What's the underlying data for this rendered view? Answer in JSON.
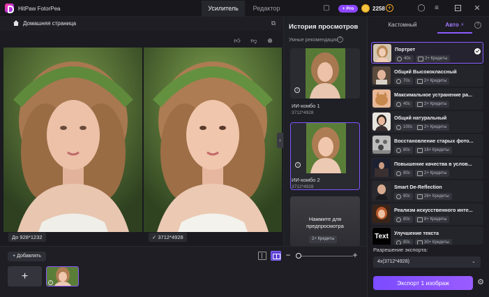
{
  "app": {
    "title": "HitPaw FotorPea",
    "coins": "2258",
    "pro_label": "+ Pro"
  },
  "tabs": {
    "enhancer": "Усилитель",
    "editor": "Редактор"
  },
  "subbar": {
    "home": "Домашняя страница"
  },
  "canvas": {
    "before_label": "До 928*1232",
    "after_label": "3712*4928"
  },
  "history": {
    "title": "История просмотров",
    "smart_rec": "Умные рекомендации",
    "items": [
      {
        "name": "ИИ-комбо 1",
        "size": "3712*4928"
      },
      {
        "name": "ИИ-комбо 2",
        "size": "3712*4928"
      }
    ],
    "preview_text": "Нажмите для предпросмотра",
    "preview_credits": "2+ Кредиты"
  },
  "bottom": {
    "add_label": "+ Добавлять",
    "add_tile": "+"
  },
  "right": {
    "tab_custom": "Кастомный",
    "tab_auto": "Авто",
    "models": [
      {
        "name": "Портрет",
        "time": "40s",
        "credits": "2+ Кредиты"
      },
      {
        "name": "Общий Высококлассный",
        "time": "70s",
        "credits": "2+ Кредиты"
      },
      {
        "name": "Максимальное устранение ра...",
        "time": "40s",
        "credits": "2+ Кредиты"
      },
      {
        "name": "Общий натуральный",
        "time": "100s",
        "credits": "2+ Кредиты"
      },
      {
        "name": "Восстановление старых фото...",
        "time": "80s",
        "credits": "16+ Кредиты"
      },
      {
        "name": "Повышение качества в услов...",
        "time": "80s",
        "credits": "2+ Кредиты"
      },
      {
        "name": "Smart De-Reflection",
        "time": "80s",
        "credits": "28+ Кредиты"
      },
      {
        "name": "Реализм искусственного инте...",
        "time": "80s",
        "credits": "8+ Кредиты"
      },
      {
        "name": "Улучшение текста",
        "time": "80s",
        "credits": "30+ Кредиты",
        "thumb_text": "Text"
      }
    ],
    "export_res_label": "Разрешение экспорта:",
    "export_res_value": "4x(3712*4928)",
    "export_button": "Экспорт 1 изображ"
  },
  "colors": {
    "accent": "#8a5cff",
    "background": "#16161b",
    "panel": "#1f1f26"
  }
}
